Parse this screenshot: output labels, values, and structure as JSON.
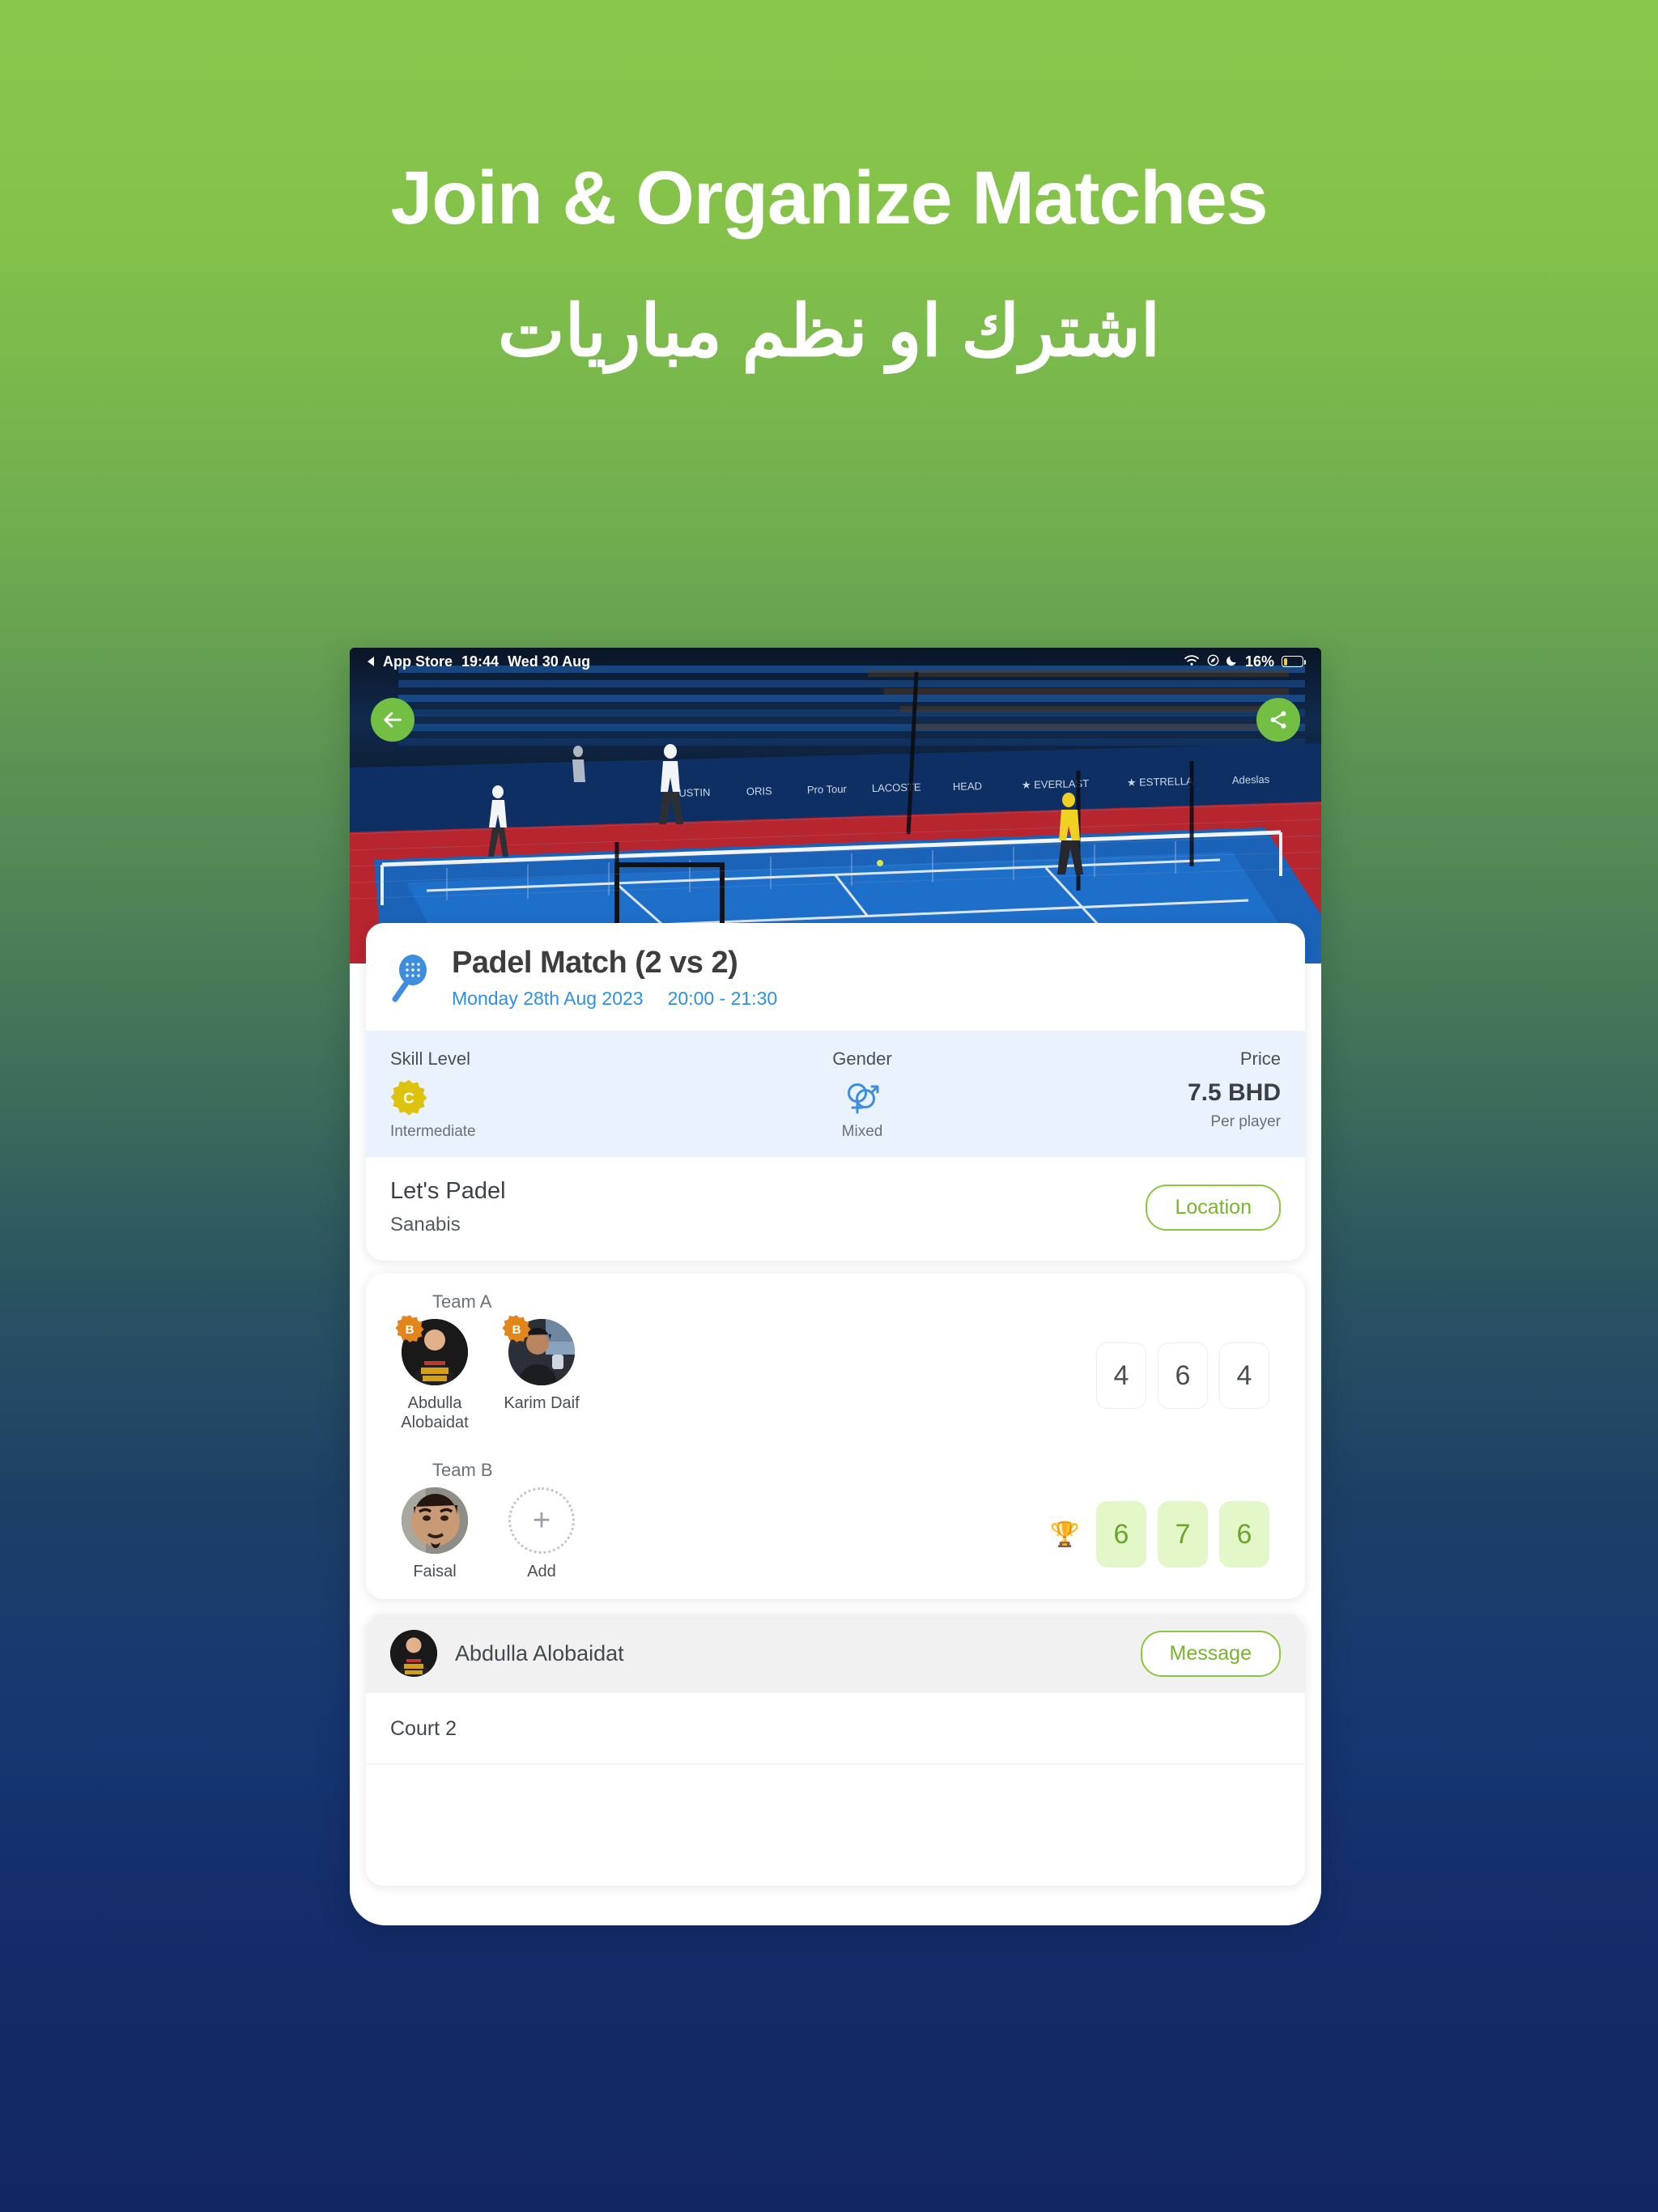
{
  "promo": {
    "headline_en": "Join & Organize Matches",
    "headline_ar": "اشترك او نظم مباريات",
    "bg_top_color": "#84c24a",
    "bg_bottom_color": "#122663"
  },
  "statusbar": {
    "back_app": "App Store",
    "time": "19:44",
    "date": "Wed 30 Aug",
    "battery_percent": "16%",
    "icons": [
      "back-triangle-icon",
      "wifi-icon",
      "location-icon",
      "moon-icon",
      "battery-icon"
    ]
  },
  "nav": {
    "back_icon": "arrow-left-icon",
    "share_icon": "share-icon",
    "accent_color": "#72bf44"
  },
  "match": {
    "icon": "padel-racket-icon",
    "title": "Padel Match (2 vs 2)",
    "date": "Monday 28th Aug 2023",
    "time": "20:00 - 21:30",
    "date_color": "#2f8fe8"
  },
  "stats": {
    "skill": {
      "label": "Skill Level",
      "badge_letter": "C",
      "badge_color": "#e3c511",
      "value": "Intermediate"
    },
    "gender": {
      "label": "Gender",
      "icon": "gender-mixed-icon",
      "value": "Mixed"
    },
    "price": {
      "label": "Price",
      "amount": "7.5 BHD",
      "value": "Per player"
    }
  },
  "venue": {
    "name": "Let's Padel",
    "area": "Sanabis",
    "location_button": "Location"
  },
  "teams": [
    {
      "label": "Team A",
      "winner": false,
      "trophy": "",
      "players": [
        {
          "name": "Abdulla Alobaidat",
          "badge_letter": "B",
          "avatar": "avatar-abdulla"
        },
        {
          "name": "Karim Daif",
          "badge_letter": "B",
          "avatar": "avatar-karim"
        }
      ],
      "add_slot": null,
      "scores": [
        "4",
        "6",
        "4"
      ]
    },
    {
      "label": "Team B",
      "winner": true,
      "trophy": "🏆",
      "players": [
        {
          "name": "Faisal",
          "badge_letter": "",
          "avatar": "avatar-faisal"
        }
      ],
      "add_slot": {
        "label": "Add",
        "icon": "plus-icon"
      },
      "scores": [
        "6",
        "7",
        "6"
      ]
    }
  ],
  "organizer": {
    "name": "Abdulla Alobaidat",
    "avatar": "avatar-abdulla",
    "message_button": "Message"
  },
  "court": {
    "label": "Court 2"
  }
}
